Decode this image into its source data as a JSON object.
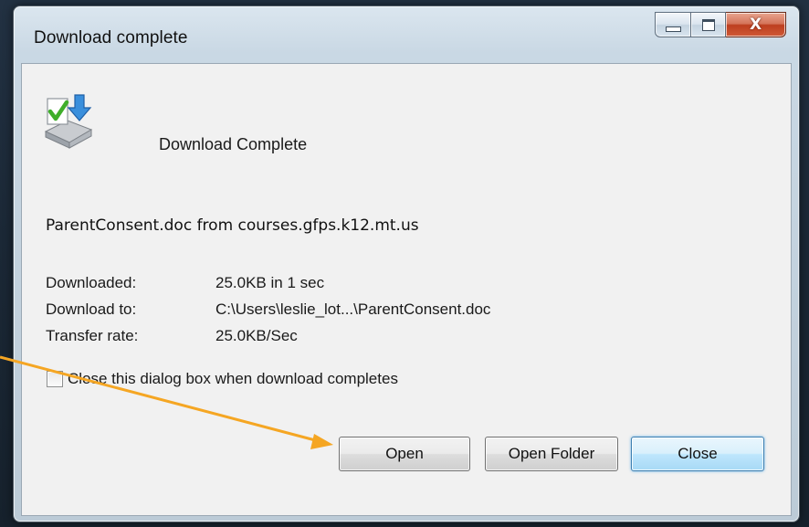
{
  "window": {
    "title": "Download complete",
    "controls": {
      "minimize": "minimize-icon",
      "maximize": "maximize-icon",
      "close": "close-icon",
      "close_glyph": "X"
    }
  },
  "dialog": {
    "heading": "Download Complete",
    "icon": "download-complete-icon",
    "source_line": "ParentConsent.doc from courses.gfps.k12.mt.us",
    "details": [
      {
        "label": "Downloaded:",
        "value": "25.0KB in 1 sec"
      },
      {
        "label": "Download to:",
        "value": "C:\\Users\\leslie_lot...\\ParentConsent.doc"
      },
      {
        "label": "Transfer rate:",
        "value": "25.0KB/Sec"
      }
    ],
    "close_on_complete": {
      "label": "Close this dialog box when download completes",
      "checked": false
    },
    "buttons": {
      "open": "Open",
      "open_folder": "Open Folder",
      "close": "Close"
    }
  },
  "annotation": {
    "icon": "arrow-annotation",
    "color": "#f5a623"
  },
  "colors": {
    "close_button_red": "#c94a28",
    "default_button_blue": "#bee6fd"
  }
}
